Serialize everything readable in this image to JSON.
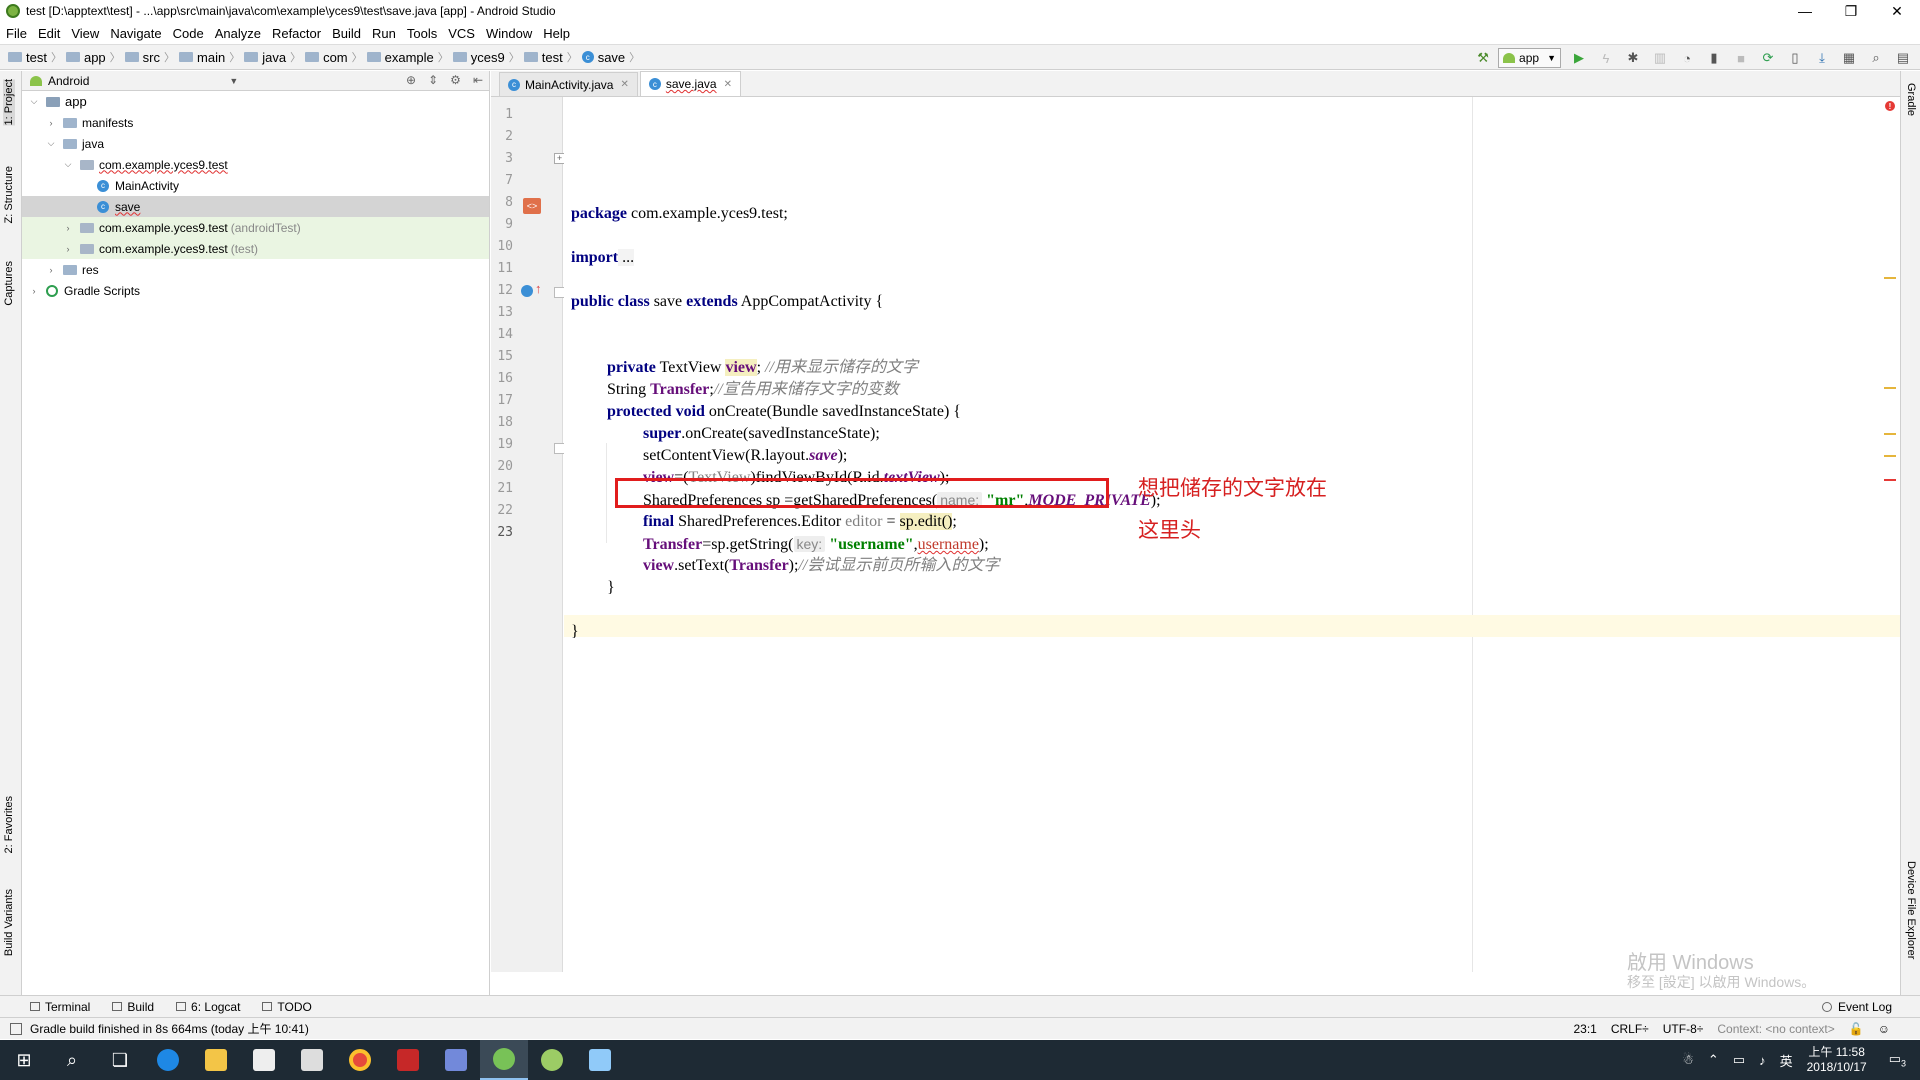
{
  "window": {
    "title": "test [D:\\apptext\\test] - ...\\app\\src\\main\\java\\com\\example\\yces9\\test\\save.java [app] - Android Studio",
    "min": "—",
    "max": "❐",
    "close": "✕"
  },
  "menu": [
    "File",
    "Edit",
    "View",
    "Navigate",
    "Code",
    "Analyze",
    "Refactor",
    "Build",
    "Run",
    "Tools",
    "VCS",
    "Window",
    "Help"
  ],
  "breadcrumbs": [
    "test",
    "app",
    "src",
    "main",
    "java",
    "com",
    "example",
    "yces9",
    "test",
    "save"
  ],
  "run_config": "app",
  "left_strip": {
    "project": "1: Project",
    "structure": "Z: Structure",
    "captures": "Captures",
    "favorites": "2: Favorites",
    "build_variants": "Build Variants"
  },
  "right_strip": {
    "gradle": "Gradle",
    "device_explorer": "Device File Explorer"
  },
  "project_panel": {
    "view": "Android",
    "tree": [
      {
        "label": "app",
        "sub": "",
        "level": 0,
        "expanded": true,
        "kind": "module"
      },
      {
        "label": "manifests",
        "sub": "",
        "level": 1,
        "expanded": false,
        "kind": "folder"
      },
      {
        "label": "java",
        "sub": "",
        "level": 1,
        "expanded": true,
        "kind": "folder"
      },
      {
        "label": "com.example.yces9.test",
        "sub": "",
        "level": 2,
        "expanded": true,
        "kind": "package"
      },
      {
        "label": "MainActivity",
        "sub": "",
        "level": 3,
        "expanded": null,
        "kind": "class"
      },
      {
        "label": "save",
        "sub": "",
        "level": 3,
        "expanded": null,
        "kind": "class"
      },
      {
        "label": "com.example.yces9.test",
        "sub": "(androidTest)",
        "level": 2,
        "expanded": false,
        "kind": "package"
      },
      {
        "label": "com.example.yces9.test",
        "sub": "(test)",
        "level": 2,
        "expanded": false,
        "kind": "package"
      },
      {
        "label": "res",
        "sub": "",
        "level": 1,
        "expanded": false,
        "kind": "folder"
      },
      {
        "label": "Gradle Scripts",
        "sub": "",
        "level": 0,
        "expanded": false,
        "kind": "gradle"
      }
    ]
  },
  "editor_tabs": [
    {
      "label": "MainActivity.java",
      "active": false
    },
    {
      "label": "save.java",
      "active": true
    }
  ],
  "line_numbers": [
    "1",
    "2",
    "3",
    "7",
    "8",
    "9",
    "10",
    "11",
    "12",
    "13",
    "14",
    "15",
    "16",
    "17",
    "18",
    "19",
    "20",
    "21",
    "22",
    "23"
  ],
  "code": {
    "l1_kw": "package",
    "l1_rest": " com.example.yces9.test;",
    "l3_kw": "import",
    "l3_rest": " ...",
    "l8_kw1": "public class",
    "l8_mid": " save ",
    "l8_kw2": "extends",
    "l8_rest": " AppCompatActivity {",
    "l10_kw": "private",
    "l10_type": " TextView ",
    "l10_field": "view",
    "l10_semi": "; ",
    "l10_cmt": "//用来显示储存的文字",
    "l11_type": "String ",
    "l11_field": "Transfer",
    "l11_semi": ";",
    "l11_cmt": "//宣告用来储存文字的变数",
    "l12_kw1": "protected",
    "l12_kw2": " void",
    "l12_rest": " onCreate(Bundle savedInstanceState) {",
    "l13_kw": "super",
    "l13_rest": ".onCreate(savedInstanceState);",
    "l14_a": "setContentView(R.layout.",
    "l14_static": "save",
    "l14_b": ");",
    "l15_field": "view",
    "l15_a": "=(",
    "l15_gray": "TextView",
    "l15_b": ")findViewById(R.id.",
    "l15_static": "textView",
    "l15_c": ");",
    "l16_a": "SharedPreferences sp =getSharedPreferences(",
    "l16_hint": "name:",
    "l16_str": "\"mr\"",
    "l16_comma": ",",
    "l16_static": "MODE_PRIVATE",
    "l16_b": ");",
    "l17_kw": "final",
    "l17_a": " SharedPreferences.Editor ",
    "l17_unused": "editor",
    "l17_b": " = ",
    "l17_warn": "sp.edit()",
    "l17_c": ";",
    "l18_field": "Transfer",
    "l18_a": "=sp.getString(",
    "l18_hint": "key:",
    "l18_str": "\"username\"",
    "l18_comma": ",",
    "l18_err": "username",
    "l18_b": ");",
    "l19_field": "view",
    "l19_a": ".setText(",
    "l19_field2": "Transfer",
    "l19_b": ");",
    "l19_cmt": "//尝试显示前页所输入的文字",
    "l20": "}",
    "l22": "}"
  },
  "annotation": {
    "line1": "想把储存的文字放在",
    "line2": "这里头"
  },
  "watermark": {
    "line1": "啟用 Windows",
    "line2": "移至 [設定] 以啟用 Windows。"
  },
  "bottom_tabs": [
    "Terminal",
    "Build",
    "6: Logcat",
    "TODO"
  ],
  "event_log": "Event Log",
  "status": {
    "message": "Gradle build finished in 8s 664ms (today 上午 10:41)",
    "position": "23:1",
    "line_sep": "CRLF÷",
    "encoding": "UTF-8÷",
    "context": "Context: <no context>"
  },
  "taskbar": {
    "clock_time": "上午 11:58",
    "clock_date": "2018/10/17",
    "ime": "英",
    "notify_count": "3"
  },
  "colors": {
    "keyword": "#000080",
    "field": "#660e7a",
    "string": "#008000",
    "comment": "#808080",
    "annotation": "#d62020",
    "taskbar": "#1e2a34"
  }
}
